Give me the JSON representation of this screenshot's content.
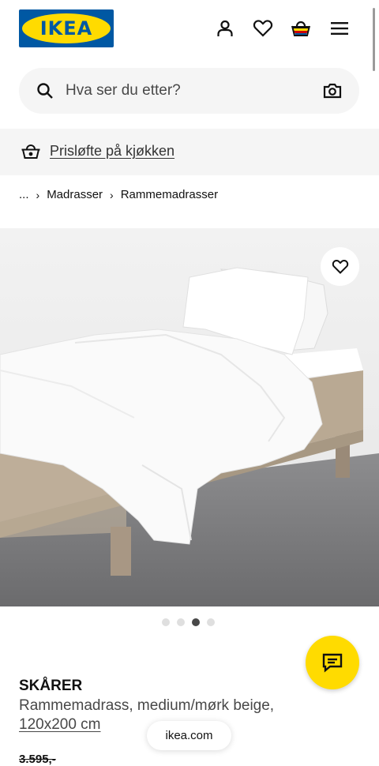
{
  "header": {
    "logo_text": "IKEA",
    "icons": [
      "user-icon",
      "heart-icon",
      "basket-icon",
      "menu-icon"
    ]
  },
  "search": {
    "placeholder": "Hva ser du etter?"
  },
  "promo": {
    "text": "Prisløfte på kjøkken"
  },
  "breadcrumb": {
    "ellipsis": "...",
    "items": [
      "Madrasser",
      "Rammemadrasser"
    ]
  },
  "gallery": {
    "image_count": 4,
    "active_index": 2
  },
  "product": {
    "name": "SKÅRER",
    "description": "Rammemadrass, medium/mørk beige,",
    "size": "120x200 cm",
    "old_price": "3.595,-"
  },
  "browser": {
    "url": "ikea.com"
  },
  "colors": {
    "ikea_blue": "#0058a3",
    "ikea_yellow": "#ffdb00"
  }
}
